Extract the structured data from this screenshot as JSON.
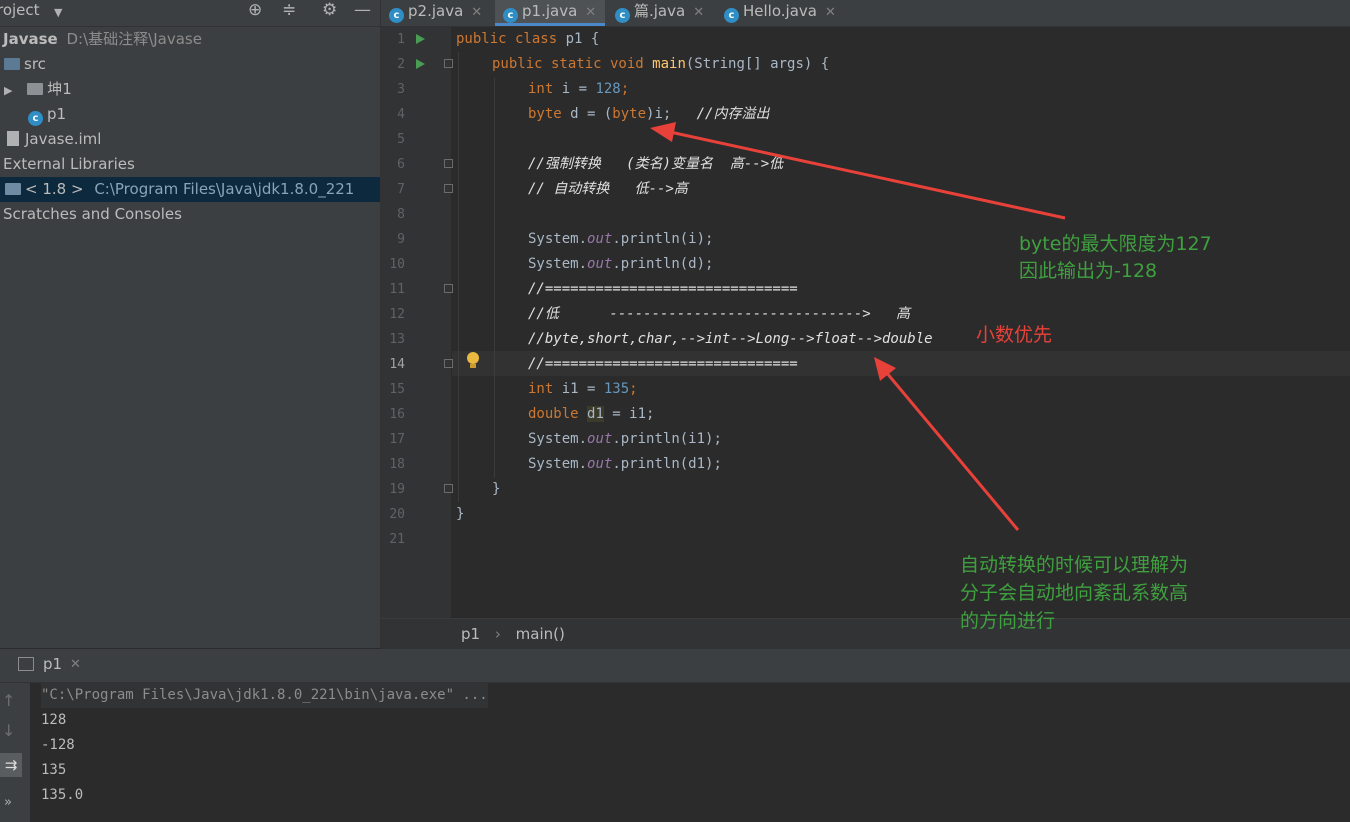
{
  "project": {
    "title": "roject",
    "header_icons": [
      "target-icon",
      "collapse-icon",
      "gear-icon",
      "minimize-icon"
    ],
    "tree": [
      {
        "label": "Javase",
        "path": "D:\\基础注释\\Javase",
        "bold": true
      },
      {
        "label": "src",
        "kind": "folder"
      },
      {
        "label": "坤1",
        "kind": "package"
      },
      {
        "label": "p1",
        "kind": "class"
      },
      {
        "label": "Javase.iml",
        "kind": "file"
      },
      {
        "label": "External Libraries"
      },
      {
        "label": "< 1.8 >",
        "path": "C:\\Program Files\\Java\\jdk1.8.0_221",
        "selected": true
      },
      {
        "label": "Scratches and Consoles"
      }
    ]
  },
  "tabs": [
    {
      "label": "p2.java",
      "active": false
    },
    {
      "label": "p1.java",
      "active": true
    },
    {
      "label": "篇.java",
      "active": false
    },
    {
      "label": "Hello.java",
      "active": false
    }
  ],
  "editor": {
    "line_numbers": [
      "1",
      "2",
      "3",
      "4",
      "5",
      "6",
      "7",
      "8",
      "9",
      "10",
      "11",
      "12",
      "13",
      "14",
      "15",
      "16",
      "17",
      "18",
      "19",
      "20",
      "21"
    ],
    "current_line": "14",
    "code": {
      "l1_kw": "public class",
      "l1_rest": " p1 {",
      "l2_kw": "public static void",
      "l2_fn": "main",
      "l2_rest": "(String[] args) {",
      "l3_kw": "int",
      "l3_mid": " i = ",
      "l3_num": "128",
      "l3_end": ";",
      "l4_kw": "byte",
      "l4_mid": " d = (",
      "l4_kw2": "byte",
      "l4_end": ")i;   ",
      "l4_cmt": "//内存溢出",
      "l6": "//强制转换   (类名)变量名  高-->低",
      "l7": "// 自动转换   低-->高",
      "l9_a": "System.",
      "l9_f": "out",
      "l9_b": ".println(i);",
      "l10_a": "System.",
      "l10_f": "out",
      "l10_b": ".println(d);",
      "l11": "//==============================",
      "l12": "//低      ------------------------------>   高",
      "l13": "//byte,short,char,-->int-->Long-->float-->double",
      "l14": "//==============================",
      "l15_kw": "int",
      "l15_mid": " i1 = ",
      "l15_num": "135",
      "l15_end": ";",
      "l16_kw": "double",
      "l16_var": "d1",
      "l16_end": " = i1;",
      "l17_a": "System.",
      "l17_f": "out",
      "l17_b": ".println(i1);",
      "l18_a": "System.",
      "l18_f": "out",
      "l18_b": ".println(d1);",
      "l19": "}",
      "l20": "}"
    }
  },
  "breadcrumb": {
    "class": "p1",
    "separator": "›",
    "method": "main()"
  },
  "run": {
    "tab_label": "p1",
    "output": [
      "\"C:\\Program Files\\Java\\jdk1.8.0_221\\bin\\java.exe\" ...",
      "128",
      "-128",
      "135",
      "135.0"
    ]
  },
  "annotations": {
    "byte_note_1": "byte的最大限度为127",
    "byte_note_2": "因此输出为-128",
    "decimal_first": "小数优先",
    "auto_note_1": "自动转换的时候可以理解为",
    "auto_note_2": "分子会自动地向紊乱系数高",
    "auto_note_3": "的方向进行"
  },
  "colors": {
    "keyword": "#cc7832",
    "number": "#6897bb",
    "method": "#ffc66d",
    "field": "#9876aa",
    "annotation_green": "#3fa03f",
    "annotation_red": "#e8413a",
    "tab_underline": "#4a88c7"
  }
}
